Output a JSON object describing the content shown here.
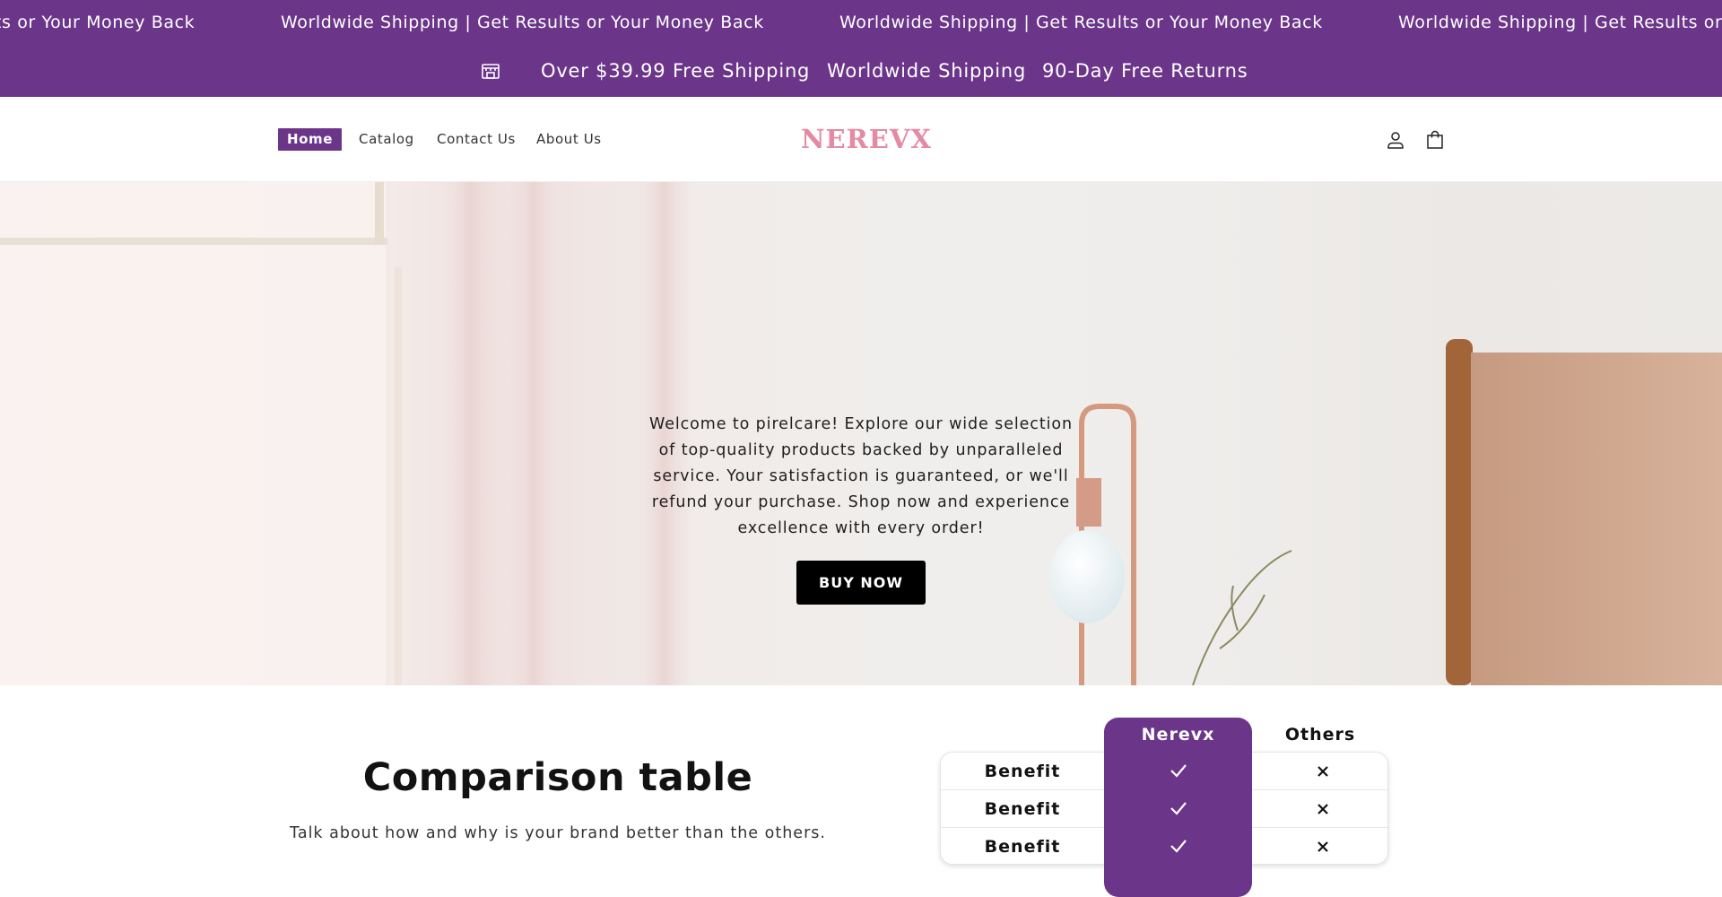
{
  "marquee": {
    "items": [
      "ts or Your Money Back",
      "Worldwide Shipping | Get Results or Your Money Back",
      "Worldwide Shipping | Get Results or Your Money Back",
      "Worldwide Shipping | Get Results or Your Money Back"
    ]
  },
  "announcement": {
    "icon": "store-icon",
    "free_shipping": "Over $39.99 Free Shipping",
    "worldwide": "Worldwide Shipping",
    "returns": "90-Day Free Returns"
  },
  "header": {
    "nav": [
      "Home",
      "Catalog",
      "Contact Us",
      "About Us"
    ],
    "logo": "NEREVX",
    "logo_color": "#e58aa3",
    "icons": [
      "account-icon",
      "cart-icon"
    ]
  },
  "hero": {
    "text": "Welcome to pirelcare! Explore our wide selection of top-quality products backed by unparalleled service. Your satisfaction is guaranteed, or we'll refund your purchase. Shop now and experience excellence with every order!",
    "button": "BUY NOW"
  },
  "comparison": {
    "title": "Comparison table",
    "subtitle": "Talk about how and why is your brand better than the others.",
    "brand_label": "Nerevx",
    "others_label": "Others",
    "rows": [
      {
        "label": "Benefit",
        "brand": "check-icon",
        "others": "x-icon"
      },
      {
        "label": "Benefit",
        "brand": "check-icon",
        "others": "x-icon"
      },
      {
        "label": "Benefit",
        "brand": "check-icon",
        "others": "x-icon"
      }
    ]
  },
  "colors": {
    "accent": "#6b3589",
    "button": "#000000"
  }
}
